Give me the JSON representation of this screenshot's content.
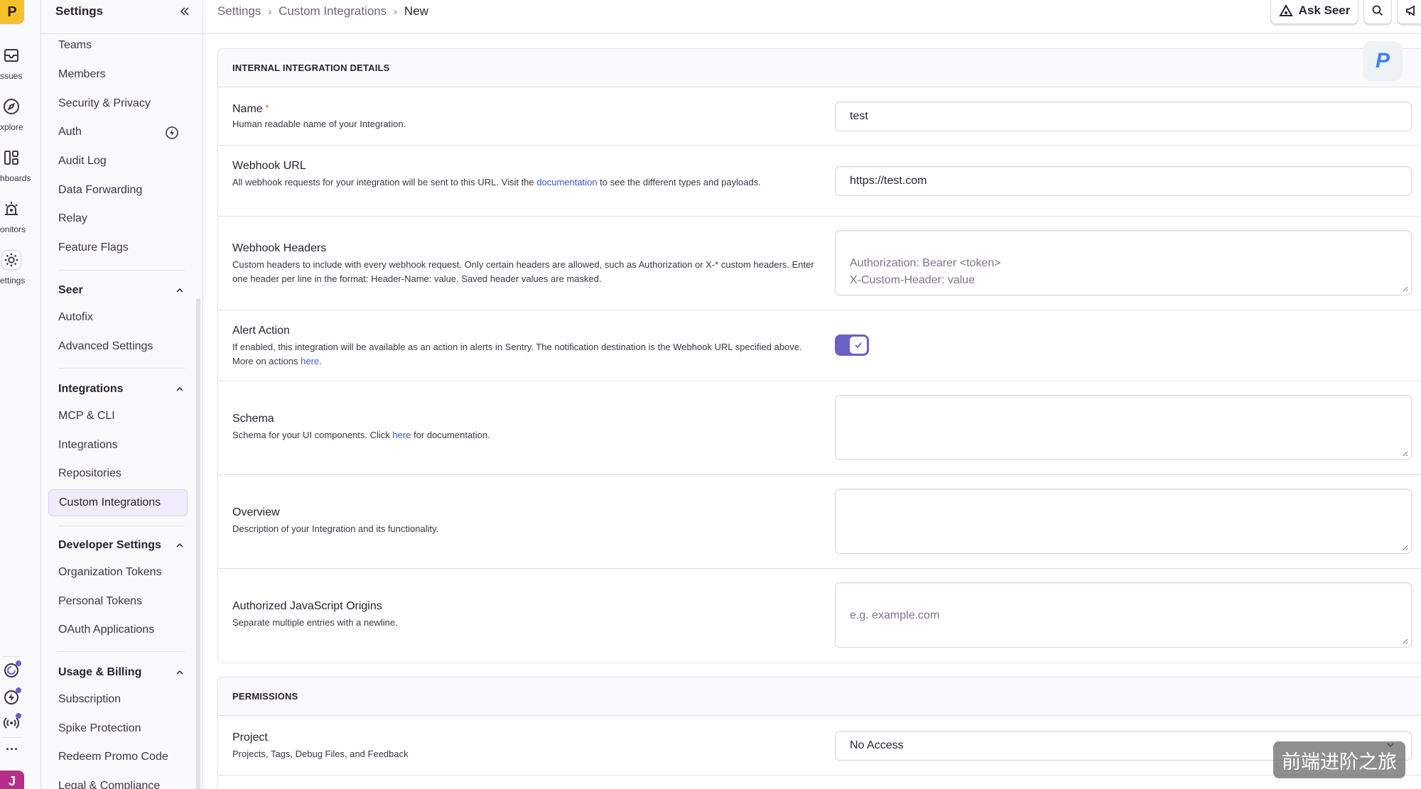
{
  "org_initial": "P",
  "user_initial": "J",
  "rail": {
    "items": [
      {
        "label": "ssues",
        "icon": "inbox-icon"
      },
      {
        "label": "xplore",
        "icon": "compass-icon"
      },
      {
        "label": "hboards",
        "icon": "dashboard-icon"
      },
      {
        "label": "onitors",
        "icon": "siren-icon"
      },
      {
        "label": "ettings",
        "icon": "gear-icon"
      }
    ],
    "more_label": "···"
  },
  "sidebar": {
    "title": "Settings",
    "items_top": [
      "Teams",
      "Members",
      "Security & Privacy",
      "Auth",
      "Audit Log",
      "Data Forwarding",
      "Relay",
      "Feature Flags"
    ],
    "seer": {
      "title": "Seer",
      "items": [
        "Autofix",
        "Advanced Settings"
      ]
    },
    "integrations": {
      "title": "Integrations",
      "items": [
        "MCP & CLI",
        "Integrations",
        "Repositories",
        "Custom Integrations"
      ]
    },
    "developer": {
      "title": "Developer Settings",
      "items": [
        "Organization Tokens",
        "Personal Tokens",
        "OAuth Applications"
      ]
    },
    "billing": {
      "title": "Usage & Billing",
      "items": [
        "Subscription",
        "Spike Protection",
        "Redeem Promo Code",
        "Legal & Compliance"
      ]
    }
  },
  "breadcrumbs": [
    "Settings",
    "Custom Integrations",
    "New"
  ],
  "topbar": {
    "ask_seer": "Ask Seer"
  },
  "details": {
    "header": "INTERNAL INTEGRATION DETAILS",
    "name": {
      "label": "Name",
      "required": "*",
      "help": "Human readable name of your Integration.",
      "value": "test"
    },
    "webhook_url": {
      "label": "Webhook URL",
      "help_before": "All webhook requests for your integration will be sent to this URL. Visit the ",
      "help_link": "documentation",
      "help_after": " to see the different types and payloads.",
      "value": "https://test.com"
    },
    "webhook_headers": {
      "label": "Webhook Headers",
      "help": "Custom headers to include with every webhook request. Only certain headers are allowed, such as Authorization or X-* custom headers. Enter one header per line in the format: Header-Name: value. Saved header values are masked.",
      "placeholder": "Authorization: Bearer <token>\nX-Custom-Header: value"
    },
    "alert_action": {
      "label": "Alert Action",
      "help_before": "If enabled, this integration will be available as an action in alerts in Sentry. The notification destination is the Webhook URL specified above. More on actions ",
      "help_link": "here",
      "help_after": ".",
      "enabled": true
    },
    "schema": {
      "label": "Schema",
      "help_before": "Schema for your UI components. Click ",
      "help_link": "here",
      "help_after": " for documentation."
    },
    "overview": {
      "label": "Overview",
      "help": "Description of your Integration and its functionality."
    },
    "origins": {
      "label": "Authorized JavaScript Origins",
      "help": "Separate multiple entries with a newline.",
      "placeholder": "e.g. example.com"
    }
  },
  "permissions": {
    "header": "PERMISSIONS",
    "project": {
      "label": "Project",
      "help": "Projects, Tags, Debug Files, and Feedback",
      "value": "No Access"
    }
  },
  "badge_letter": "P",
  "watermark": "前端进阶之旅",
  "colors": {
    "accent": "#6c5fc7",
    "link": "#3d52d5",
    "required": "#e03e2f",
    "org_badge": "#f6c02b",
    "user_badge": "#b62d8a"
  }
}
